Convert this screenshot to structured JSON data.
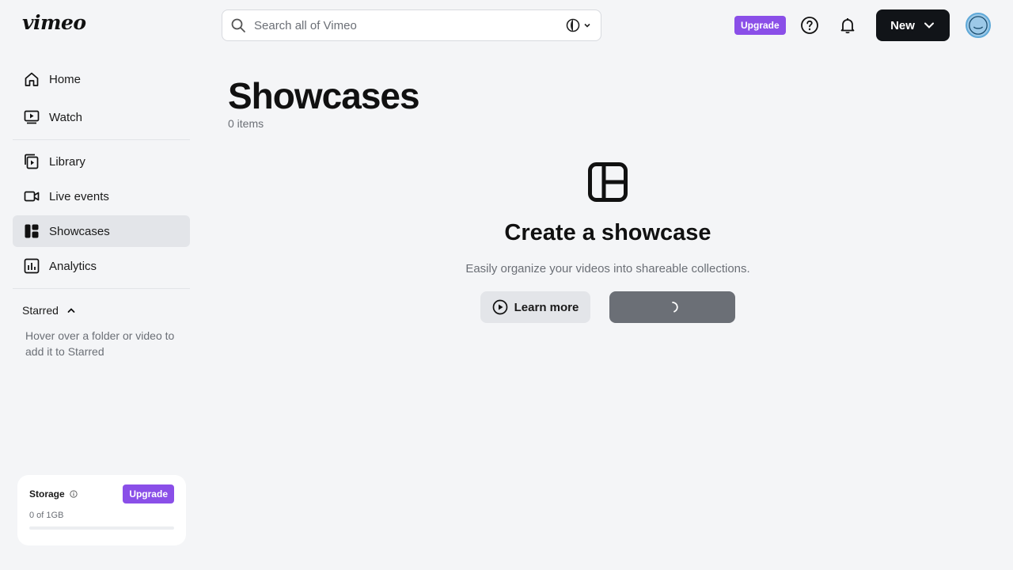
{
  "header": {
    "logo": "vimeo",
    "search_placeholder": "Search all of Vimeo",
    "upgrade_label": "Upgrade",
    "new_label": "New",
    "accent": "#8a4fe8"
  },
  "sidebar": {
    "items": [
      {
        "label": "Home",
        "icon": "home-icon"
      },
      {
        "label": "Watch",
        "icon": "watch-icon"
      },
      {
        "label": "Library",
        "icon": "library-icon"
      },
      {
        "label": "Live events",
        "icon": "camera-icon"
      },
      {
        "label": "Showcases",
        "icon": "showcase-icon",
        "active": true
      },
      {
        "label": "Analytics",
        "icon": "analytics-icon"
      }
    ],
    "starred": {
      "title": "Starred",
      "hint": "Hover over a folder or video to add it to Starred"
    },
    "storage": {
      "label": "Storage",
      "upgrade_label": "Upgrade",
      "amount": "0 of 1GB",
      "used_fraction": 0
    }
  },
  "main": {
    "title": "Showcases",
    "count": "0 items",
    "empty": {
      "title": "Create a showcase",
      "subtitle": "Easily organize your videos into shareable collections.",
      "learn_more": "Learn more"
    }
  }
}
